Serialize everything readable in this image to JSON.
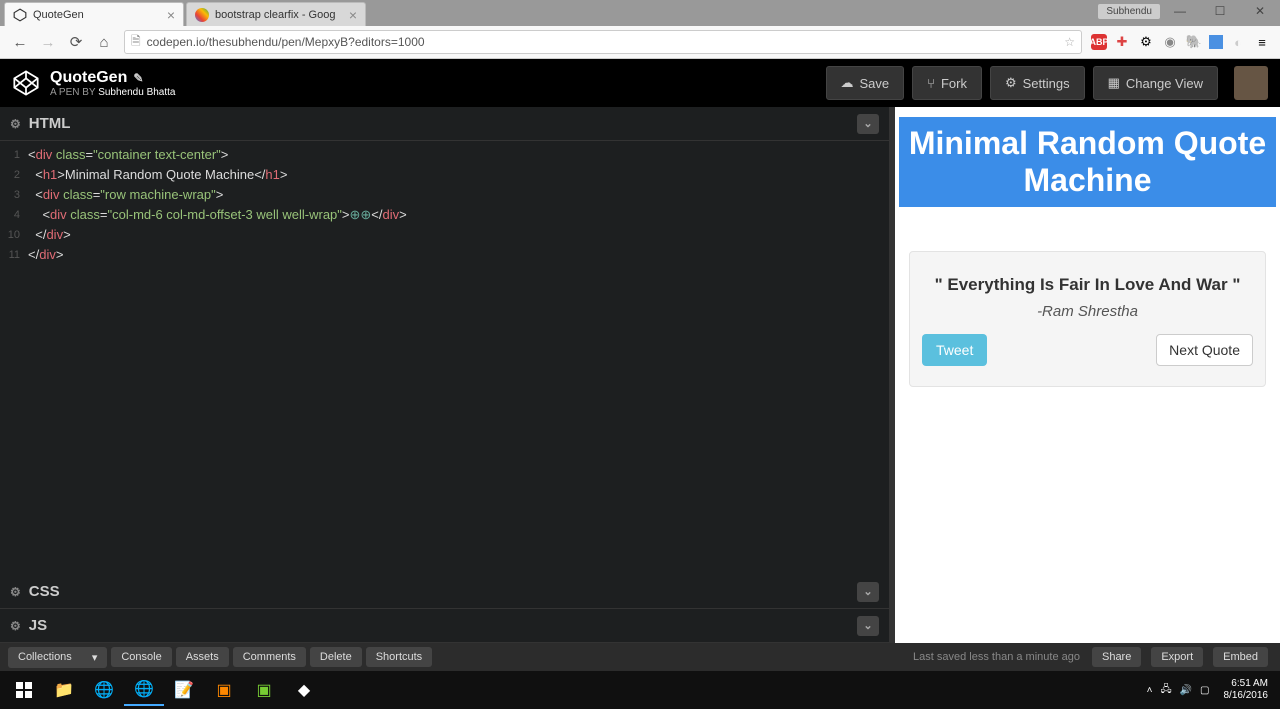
{
  "browser": {
    "tabs": [
      {
        "title": "QuoteGen",
        "active": true
      },
      {
        "title": "bootstrap clearfix - Goog",
        "active": false
      }
    ],
    "user_badge": "Subhendu",
    "url": "codepen.io/thesubhendu/pen/MepxyB?editors=1000"
  },
  "codepen": {
    "title": "QuoteGen",
    "byline_prefix": "A PEN BY ",
    "author": "Subhendu Bhatta",
    "actions": {
      "save": "Save",
      "fork": "Fork",
      "settings": "Settings",
      "change_view": "Change View"
    },
    "panels": {
      "html": "HTML",
      "css": "CSS",
      "js": "JS"
    },
    "code_lines": [
      {
        "n": "1",
        "html": "<span class='txt'>&lt;</span><span class='tag'>div</span> <span class='attr'>class</span><span class='txt'>=</span><span class='val'>\"container text-center\"</span><span class='txt'>&gt;</span>"
      },
      {
        "n": "2",
        "html": "  <span class='txt'>&lt;</span><span class='tag'>h1</span><span class='txt'>&gt;</span><span class='txt'>Minimal Random Quote Machine</span><span class='txt'>&lt;/</span><span class='tag'>h1</span><span class='txt'>&gt;</span>"
      },
      {
        "n": "3",
        "html": "  <span class='txt'>&lt;</span><span class='tag'>div</span> <span class='attr'>class</span><span class='txt'>=</span><span class='val'>\"row machine-wrap\"</span><span class='txt'>&gt;</span>"
      },
      {
        "n": "4",
        "html": "    <span class='txt'>&lt;</span><span class='tag'>div</span> <span class='attr'>class</span><span class='txt'>=</span><span class='val'>\"col-md-6 col-md-offset-3 well well-wrap\"</span><span class='txt'>&gt;</span><span style='color:#6a9'>⊕⊕</span><span class='txt'>&lt;/</span><span class='tag'>div</span><span class='txt'>&gt;</span>"
      },
      {
        "n": "10",
        "html": "  <span class='txt'>&lt;/</span><span class='tag'>div</span><span class='txt'>&gt;</span>"
      },
      {
        "n": "11",
        "html": "<span class='txt'>&lt;/</span><span class='tag'>div</span><span class='txt'>&gt;</span>"
      }
    ],
    "footer": {
      "collections": "Collections",
      "console": "Console",
      "assets": "Assets",
      "comments": "Comments",
      "delete": "Delete",
      "shortcuts": "Shortcuts",
      "saved": "Last saved less than a minute ago",
      "share": "Share",
      "export": "Export",
      "embed": "Embed"
    }
  },
  "preview": {
    "heading": "Minimal Random Quote Machine",
    "quote": "\" Everything Is Fair In Love And War \"",
    "author": "-Ram Shrestha",
    "tweet": "Tweet",
    "next": "Next Quote"
  },
  "taskbar": {
    "time": "6:51 AM",
    "date": "8/16/2016"
  }
}
